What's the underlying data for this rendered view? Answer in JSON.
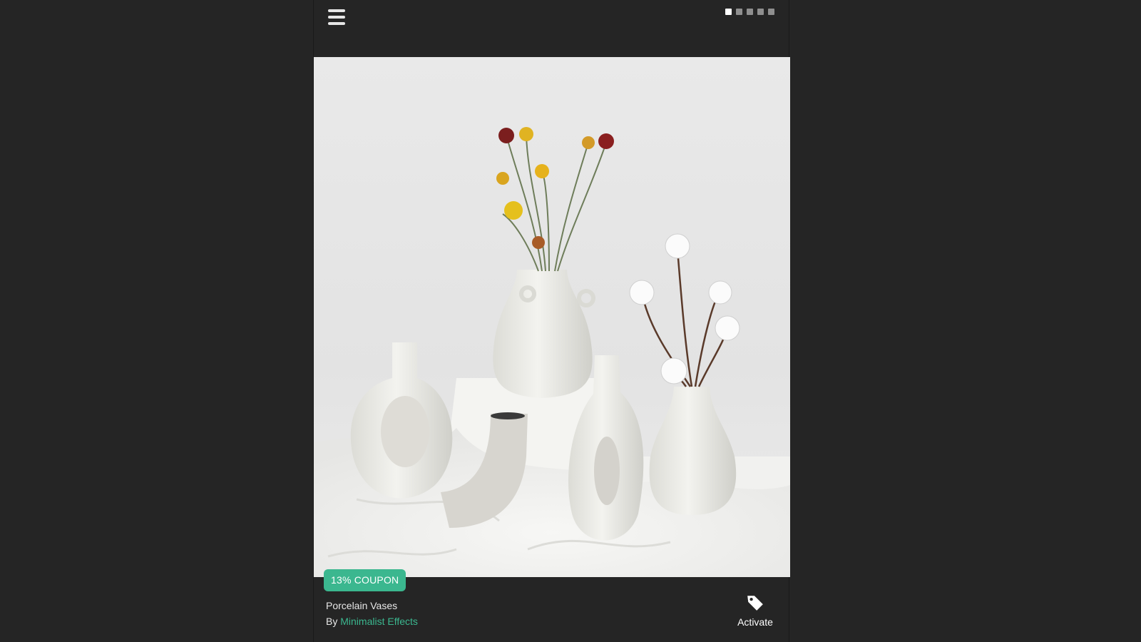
{
  "header": {
    "menu_icon": "hamburger-menu-icon",
    "carousel_dots": {
      "count": 5,
      "active_index": 0
    }
  },
  "product": {
    "image_alt": "Porcelain Vases",
    "coupon_label": "13% COUPON",
    "title": "Porcelain Vases",
    "by_prefix": "By",
    "brand": "Minimalist Effects",
    "activate_label": "Activate",
    "activate_icon": "tag-icon"
  },
  "colors": {
    "background": "#252525",
    "accent": "#3bb78f",
    "text": "#e8e8e8"
  }
}
